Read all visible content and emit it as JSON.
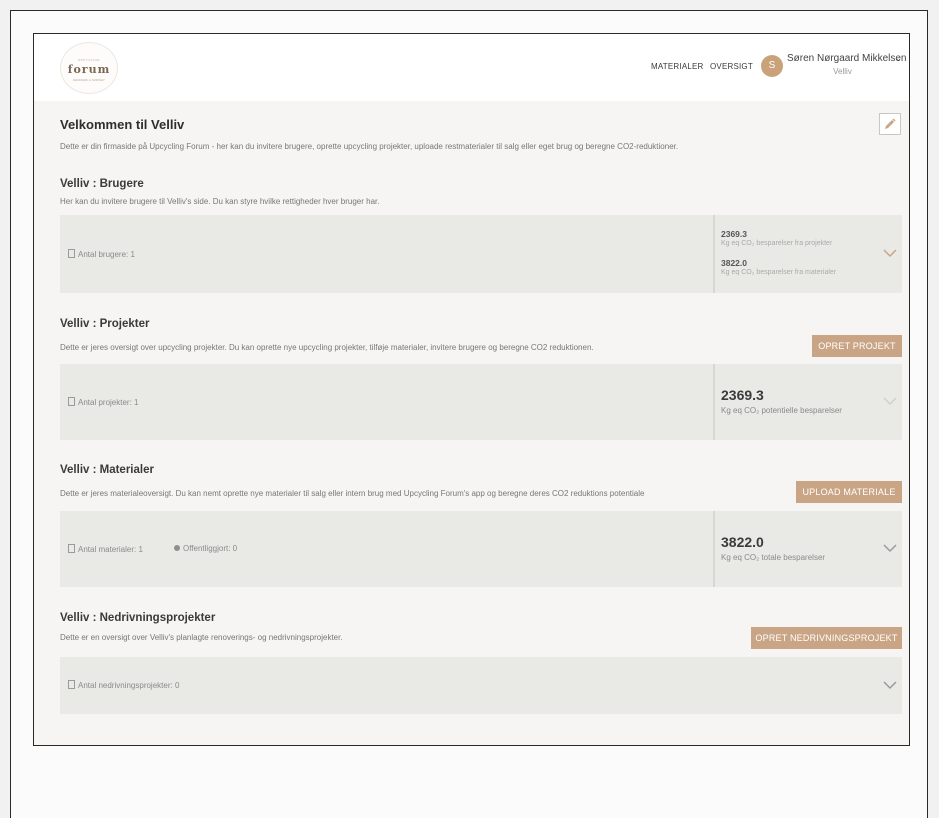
{
  "header": {
    "logo_small": "UPCYCLING",
    "logo_word": "forum",
    "logo_sub": "DENMARK & NORWAY",
    "nav_materialer": "MATERIALER",
    "nav_oversigt": "OVERSIGT",
    "avatar_initial": "S",
    "user_name": "Søren Nørgaard Mikkelsen",
    "user_company": "Velliv",
    "chevron_glyph": "⌄"
  },
  "welcome": {
    "title": "Velkommen til Velliv",
    "description": "Dette er din firmaside på Upcycling Forum - her kan du invitere brugere, oprette upcycling projekter, uploade restmaterialer til salg eller eget brug og beregne CO2-reduktioner."
  },
  "users_section": {
    "title": "Velliv : Brugere",
    "description": "Her kan du invitere brugere til Velliv's side. Du kan styre hvilke rettigheder hver bruger har.",
    "count_label": "Antal brugere: 1",
    "stat1_value": "2369.3",
    "stat1_label": "Kg eq CO₂ besparelser fra projekter",
    "stat2_value": "3822.0",
    "stat2_label": "Kg eq CO₂ besparelser fra materialer"
  },
  "projects_section": {
    "title": "Velliv : Projekter",
    "description": "Dette er jeres oversigt over upcycling projekter. Du kan oprette nye upcycling projekter, tilføje materialer, invitere brugere og beregne CO2 reduktionen.",
    "button_label": "OPRET PROJEKT",
    "count_label": "Antal projekter: 1",
    "stat_value": "2369.3",
    "stat_label": "Kg eq CO₂ potentielle besparelser"
  },
  "materials_section": {
    "title": "Velliv : Materialer",
    "description": "Dette er jeres materialeoversigt. Du kan nemt oprette nye materialer til salg eller intern brug med Upcycling Forum's app og beregne deres CO2 reduktions potentiale",
    "button_label": "UPLOAD MATERIALE",
    "count_label": "Antal materialer: 1",
    "published_label": "Offentliggjort: 0",
    "stat_value": "3822.0",
    "stat_label": "Kg eq CO₂ totale besparelser"
  },
  "demolition_section": {
    "title": "Velliv : Nedrivningsprojekter",
    "description": "Dette er en oversigt over Velliv's planlagte renoverings- og nedrivningsprojekter.",
    "button_label": "OPRET NEDRIVNINGSPROJEKT",
    "count_label": "Antal nedrivningsprojekter: 0"
  },
  "colors": {
    "accent": "#c9a585",
    "avatar": "#c9a27a",
    "card_bg": "#e9e9e6",
    "page_bg": "#f6f5f3"
  }
}
